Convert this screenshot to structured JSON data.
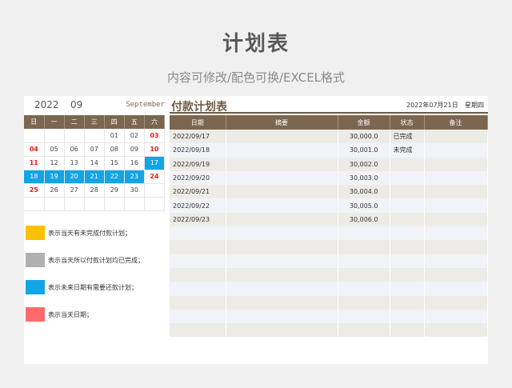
{
  "header": {
    "title": "计划表",
    "subtitle": "内容可修改/配色可换/EXCEL格式"
  },
  "calendar": {
    "year": "2022",
    "month": "09",
    "month_en": "September",
    "weekdays": [
      "日",
      "一",
      "二",
      "三",
      "四",
      "五",
      "六"
    ],
    "weeks": [
      [
        "",
        "",
        "",
        "",
        "01",
        "02",
        "03"
      ],
      [
        "04",
        "05",
        "06",
        "07",
        "08",
        "09",
        "10"
      ],
      [
        "11",
        "12",
        "13",
        "14",
        "15",
        "16",
        "17"
      ],
      [
        "18",
        "19",
        "20",
        "21",
        "22",
        "23",
        "24"
      ],
      [
        "25",
        "26",
        "27",
        "28",
        "29",
        "30",
        ""
      ],
      [
        "",
        "",
        "",
        "",
        "",
        "",
        ""
      ]
    ],
    "red_days": [
      "03",
      "04",
      "10",
      "11",
      "24",
      "25"
    ],
    "blue_days": [
      "17",
      "18",
      "19",
      "20",
      "21",
      "22",
      "23"
    ],
    "colors": {
      "header_bg": "#7b6650",
      "weekend_red": "#e0201c",
      "highlight_blue": "#12a5e5"
    }
  },
  "legend": [
    {
      "color": "#ffc000",
      "text": "表示当天有未完成付款计划；"
    },
    {
      "color": "#b0b0b0",
      "text": "表示当天所以付款计划均已完成；"
    },
    {
      "color": "#12a5e5",
      "text": "表示未来日期有需要还款计划；"
    },
    {
      "color": "#ff6b6b",
      "text": "表示当天日期；"
    }
  ],
  "plan": {
    "title": "付款计划表",
    "date": "2022年07月21日",
    "weekday": "星期四",
    "columns": [
      "日期",
      "摘要",
      "金额",
      "状态",
      "备注"
    ],
    "rows": [
      [
        "2022/09/17",
        "",
        "30,000.0",
        "已完成",
        ""
      ],
      [
        "2022/09/18",
        "",
        "30,001.0",
        "未完成",
        ""
      ],
      [
        "2022/09/19",
        "",
        "30,002.0",
        "",
        ""
      ],
      [
        "2022/09/20",
        "",
        "30,003.0",
        "",
        ""
      ],
      [
        "2022/09/21",
        "",
        "30,004.0",
        "",
        ""
      ],
      [
        "2022/09/22",
        "",
        "30,005.0",
        "",
        ""
      ],
      [
        "2022/09/23",
        "",
        "30,006.0",
        "",
        ""
      ],
      [
        "",
        "",
        "",
        "",
        ""
      ],
      [
        "",
        "",
        "",
        "",
        ""
      ],
      [
        "",
        "",
        "",
        "",
        ""
      ],
      [
        "",
        "",
        "",
        "",
        ""
      ],
      [
        "",
        "",
        "",
        "",
        ""
      ],
      [
        "",
        "",
        "",
        "",
        ""
      ],
      [
        "",
        "",
        "",
        "",
        ""
      ],
      [
        "",
        "",
        "",
        "",
        ""
      ]
    ]
  }
}
